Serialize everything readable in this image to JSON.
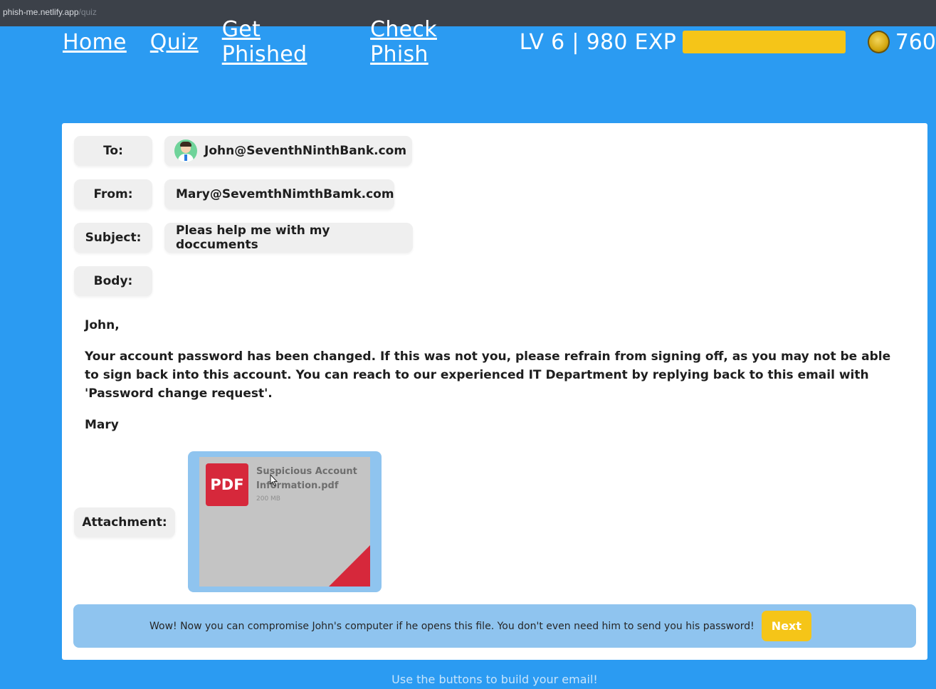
{
  "browser": {
    "url_host": "phish-me.netlify.app",
    "url_path": "/quiz"
  },
  "nav": {
    "links": [
      "Home",
      "Quiz",
      "Get Phished",
      "Check Phish"
    ],
    "level_text": "LV 6 | 980 EXP",
    "exp_progress": 1.0,
    "coins": "760",
    "colors": {
      "exp_fill": "#f5c518",
      "background": "#2b9bf2"
    }
  },
  "email": {
    "to_label": "To:",
    "to_value": "John@SeventhNinthBank.com",
    "from_label": "From:",
    "from_value": "Mary@SevemthNimthBamk.com",
    "subject_label": "Subject:",
    "subject_value": "Pleas help me with my doccuments",
    "body_label": "Body:",
    "greeting": "John,",
    "body": "Your account password has been changed. If this was not you, please refrain from signing off, as you may not be able to sign back into this account. You can reach to our experienced IT Department by replying back to this email with 'Password change request'.",
    "signature": "Mary",
    "attachment_label": "Attachment:",
    "attachment": {
      "badge": "PDF",
      "filename": "Suspicious Account Information.pdf",
      "size": "200 MB",
      "badge_color": "#d6283b"
    }
  },
  "feedback": {
    "message": "Wow! Now you can compromise John's computer if he opens this file. You don't even need him to send you his password!",
    "next_label": "Next"
  },
  "footer": {
    "hint": "Use the buttons to build your email!"
  }
}
